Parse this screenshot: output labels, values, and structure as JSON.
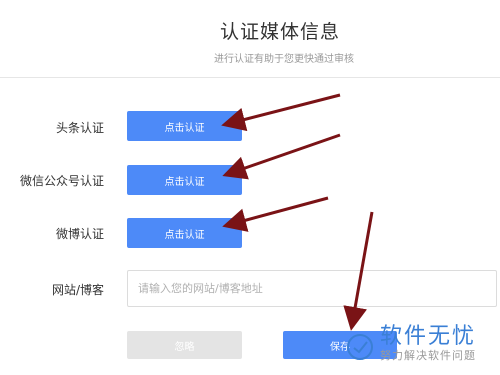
{
  "header": {
    "title": "认证媒体信息",
    "subtitle": "进行认证有助于您更快通过审核"
  },
  "rows": [
    {
      "label": "头条认证",
      "button": "点击认证"
    },
    {
      "label": "微信公众号认证",
      "button": "点击认证"
    },
    {
      "label": "微博认证",
      "button": "点击认证"
    }
  ],
  "website": {
    "label": "网站/博客",
    "placeholder": "请输入您的网站/博客地址",
    "value": ""
  },
  "actions": {
    "ignore_label": "忽略",
    "save_label": "保存"
  },
  "watermark": {
    "title": "软件无忧",
    "subtitle": "努力解决软件问题"
  },
  "colors": {
    "primary": "#4d8af8",
    "disabled": "#e4e4e4",
    "annotation_arrow": "#7a1316",
    "watermark": "#3a7fd5"
  }
}
